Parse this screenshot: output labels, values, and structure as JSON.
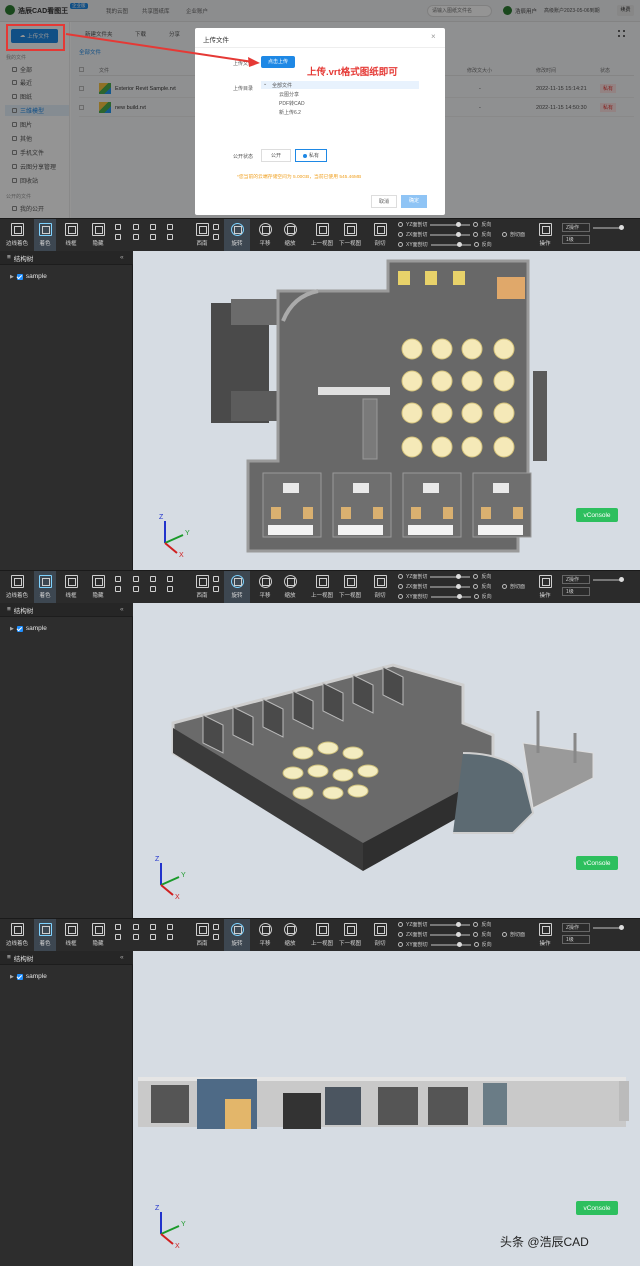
{
  "topbar": {
    "logo_text": "浩辰CAD看图王",
    "logo_badge": "企业版",
    "nav": [
      "我的云图",
      "共享图纸库",
      "企业账户"
    ],
    "search_placeholder": "请输入图纸文件名",
    "user_name": "浩辰用户",
    "account_info": "高级账户2023-05-06到期",
    "renew_button": "续费"
  },
  "sidebar": {
    "upload_button": "上传文件",
    "section_mine": "我的文件",
    "items": [
      "全部",
      "最近",
      "图纸",
      "三维模型",
      "图片",
      "其他",
      "手机文件",
      "云图分享管理",
      "回收站"
    ],
    "section_public": "公开的文件",
    "item_public": "我的公开"
  },
  "main": {
    "actions": [
      "新建文件夹",
      "下载",
      "分享"
    ],
    "breadcrumb": "全部文件",
    "columns": [
      "文件",
      "修改文大小",
      "修改时间",
      "状态"
    ],
    "rows": [
      {
        "name": "Exterior Revit Sample.rvt",
        "size": "-",
        "time": "2022-11-15 15:14:21",
        "status": "私有"
      },
      {
        "name": "new build.rvt",
        "size": "-",
        "time": "2022-11-15 14:50:30",
        "status": "私有"
      }
    ]
  },
  "modal": {
    "title": "上传文件",
    "close": "×",
    "choose_label": "上传文件",
    "choose_button": "点击上传",
    "dir_label": "上传目录",
    "tree": [
      "全部文件",
      "云图分享",
      "PDF转CAD",
      "新上传6.2"
    ],
    "public_label": "公开状态",
    "opt_public": "公开",
    "opt_private": "私有",
    "note": "*您当前的云端存储空间为 5.00GB，当前已使用 545.46MB",
    "cancel": "取消",
    "confirm": "确定"
  },
  "annotation": "上传.vrt格式图纸即可",
  "toolbar": {
    "left_buttons": [
      "边线着色",
      "着色",
      "线框",
      "隐藏"
    ],
    "mid_buttons": [
      "西南",
      "旋转",
      "平移",
      "缩放",
      "上一视图",
      "下一视图",
      "剖切"
    ],
    "section_rows": [
      "YZ面剖切",
      "ZX面剖切",
      "XY面剖切"
    ],
    "reverse": "反向",
    "section_toggle": "剖切面",
    "operate": "操作",
    "z_mode": "Z操作",
    "level": "1级"
  },
  "tree": {
    "title": "结构树",
    "collapse": "«",
    "node": "sample"
  },
  "vconsole": "vConsole",
  "watermark": "头条 @浩辰CAD",
  "colors": {
    "accent": "#1e88e5",
    "annotation": "#e53935",
    "viewer_bg": "#2b2b2b",
    "canvas_bg": "#d6dce3",
    "vconsole": "#2dbf5e"
  }
}
